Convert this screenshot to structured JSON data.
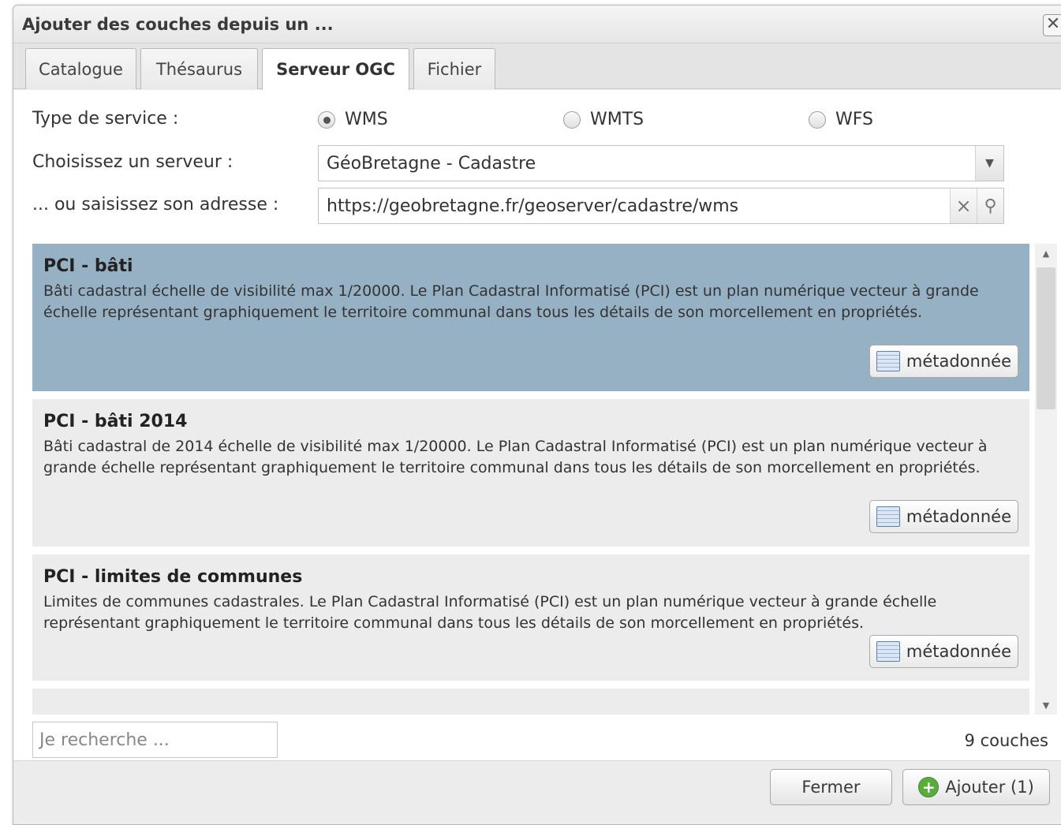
{
  "window": {
    "title": "Ajouter des couches depuis un ...",
    "close_glyph": "✕"
  },
  "tabs": [
    {
      "label": "Catalogue",
      "active": false
    },
    {
      "label": "Thésaurus",
      "active": false
    },
    {
      "label": "Serveur OGC",
      "active": true
    },
    {
      "label": "Fichier",
      "active": false
    }
  ],
  "form": {
    "service_type_label": "Type de service :",
    "service_types": [
      {
        "label": "WMS",
        "checked": true
      },
      {
        "label": "WMTS",
        "checked": false
      },
      {
        "label": "WFS",
        "checked": false
      }
    ],
    "server_label": "Choisissez un serveur :",
    "server_selected": "GéoBretagne - Cadastre",
    "address_label": "... ou saisissez son adresse :",
    "address_value": "https://geobretagne.fr/geoserver/cadastre/wms",
    "clear_glyph": "×",
    "search_glyph": "⚲"
  },
  "layers": [
    {
      "name": "PCI - bâti",
      "description": "Bâti cadastral échelle de visibilité max 1/20000. Le Plan Cadastral Informatisé (PCI) est un plan numérique vecteur à grande échelle représentant graphiquement le territoire communal dans tous les détails de son morcellement en propriétés.",
      "selected": true,
      "metadata_label": "métadonnée"
    },
    {
      "name": "PCI - bâti 2014",
      "description": "Bâti cadastral de 2014 échelle de visibilité max 1/20000. Le Plan Cadastral Informatisé (PCI) est un plan numérique vecteur à grande échelle représentant graphiquement le territoire communal dans tous les détails de son morcellement en propriétés.",
      "selected": false,
      "metadata_label": "métadonnée"
    },
    {
      "name": "PCI - limites de communes",
      "description": "Limites de communes cadastrales. Le Plan Cadastral Informatisé (PCI) est un plan numérique vecteur à grande échelle représentant graphiquement le territoire communal dans tous les détails de son morcellement en propriétés.",
      "selected": false,
      "metadata_label": "métadonnée"
    }
  ],
  "footer": {
    "search_placeholder": "Je recherche ...",
    "layer_count": "9 couches",
    "close_label": "Fermer",
    "add_label": "Ajouter (1)"
  },
  "colors": {
    "selected_row": "#97b1c4",
    "row": "#ececec",
    "add_icon": "#5aac3d"
  }
}
